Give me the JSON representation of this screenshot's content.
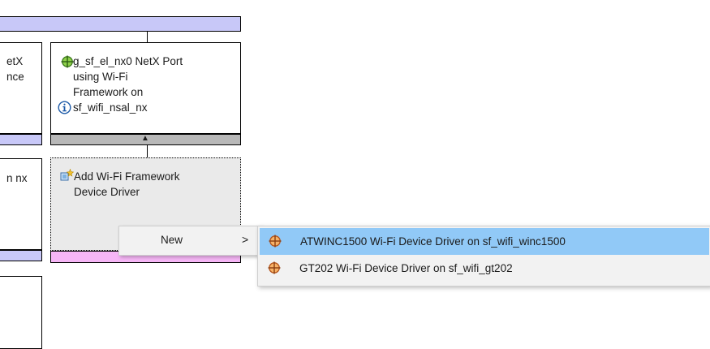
{
  "left_column": {
    "box1_text": [
      "etX",
      "nce"
    ],
    "box2_text": [
      "n nx"
    ]
  },
  "netx_card": {
    "lines": [
      "g_sf_el_nx0 NetX Port",
      "using Wi-Fi",
      "Framework on",
      "sf_wifi_nsal_nx"
    ],
    "icon": "module-icon",
    "info_icon": "info-icon",
    "arrow": "▲"
  },
  "add_card": {
    "lines": [
      "Add Wi-Fi Framework",
      "Device Driver"
    ],
    "icon": "add-component-icon"
  },
  "context_menu": {
    "new_label": "New",
    "submenu_arrow": ">"
  },
  "submenu": {
    "items": [
      {
        "label": "ATWINC1500 Wi-Fi Device Driver on sf_wifi_winc1500",
        "icon": "driver-icon",
        "highlighted": true
      },
      {
        "label": "GT202 Wi-Fi Device Driver on sf_wifi_gt202",
        "icon": "driver-icon",
        "highlighted": false
      }
    ]
  },
  "colors": {
    "purple_strip": "#c8c8f8",
    "pink_strip": "#f6b6f6",
    "gray_strip": "#b8b8b8",
    "highlight": "#91c9f7"
  }
}
